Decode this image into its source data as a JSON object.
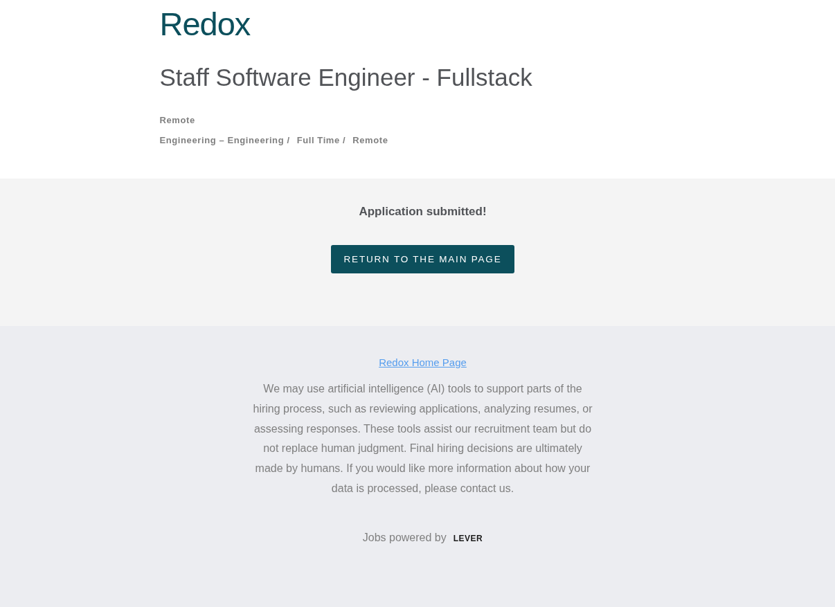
{
  "header": {
    "logo": "Redox",
    "title": "Staff Software Engineer - Fullstack",
    "location": "Remote",
    "categories": [
      "Engineering – Engineering /",
      "Full Time /",
      "Remote"
    ]
  },
  "confirmation": {
    "message": "Application submitted!",
    "button": "RETURN TO THE MAIN PAGE"
  },
  "footer": {
    "link": "Redox Home Page",
    "notice": "We may use artificial intelligence (AI) tools to support parts of the hiring process, such as reviewing applications, analyzing resumes, or assessing responses. These tools assist our recruitment team but do not replace human judgment. Final hiring decisions are ultimately made by humans. If you would like more information about how your data is processed, please contact us.",
    "powered_by": "Jobs powered by",
    "powered_logo": "LEVER"
  }
}
